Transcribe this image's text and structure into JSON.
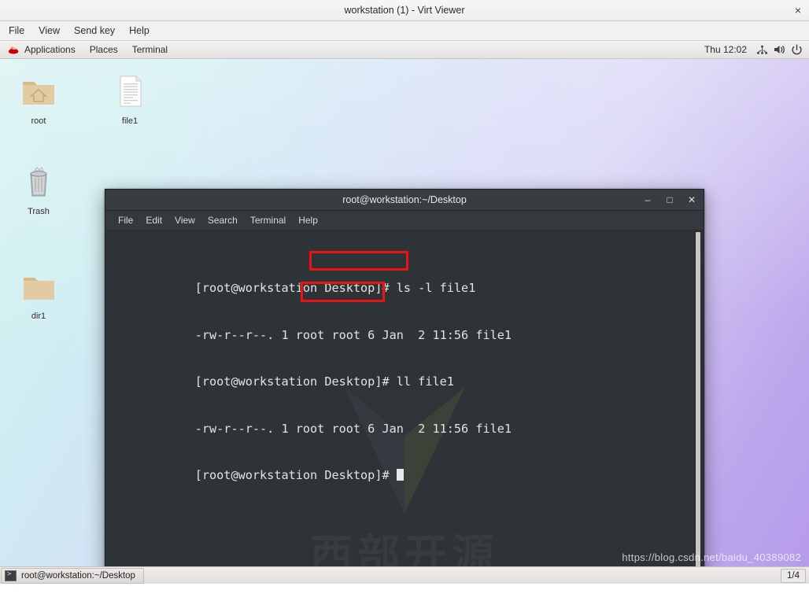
{
  "virt_viewer": {
    "title": "workstation (1) - Virt Viewer",
    "close_label": "×",
    "menu": [
      "File",
      "View",
      "Send key",
      "Help"
    ]
  },
  "gnome_panel": {
    "apps_label": "Applications",
    "places_label": "Places",
    "terminal_label": "Terminal",
    "clock": "Thu 12:02",
    "tray": [
      "network-icon",
      "volume-icon",
      "power-icon"
    ]
  },
  "desktop": {
    "icons": [
      {
        "label": "root",
        "type": "home-folder-icon"
      },
      {
        "label": "file1",
        "type": "text-file-icon"
      },
      {
        "label": "Trash",
        "type": "trash-icon"
      },
      {
        "label": "dir1",
        "type": "folder-icon"
      }
    ]
  },
  "terminal": {
    "title": "root@workstation:~/Desktop",
    "minimize_label": "–",
    "maximize_label": "□",
    "close_label": "✕",
    "menu": [
      "File",
      "Edit",
      "View",
      "Search",
      "Terminal",
      "Help"
    ],
    "watermark_text": "西部开源",
    "prompt": "[root@workstation Desktop]#",
    "lines": [
      {
        "prompt": "[root@workstation Desktop]# ",
        "text": "ls -l file1",
        "highlighted": true
      },
      {
        "prompt": "",
        "text": "-rw-r--r--. 1 root root 6 Jan  2 11:56 file1",
        "highlighted": false
      },
      {
        "prompt": "[root@workstation Desktop]# ",
        "text": "ll file1",
        "highlighted": true
      },
      {
        "prompt": "",
        "text": "-rw-r--r--. 1 root root 6 Jan  2 11:56 file1",
        "highlighted": false
      },
      {
        "prompt": "[root@workstation Desktop]# ",
        "text": "",
        "highlighted": false
      }
    ]
  },
  "taskbar": {
    "window_button": "root@workstation:~/Desktop",
    "page_indicator": "1/4"
  },
  "watermark": {
    "csdn": "https://blog.csdn.net/baidu_40389082"
  },
  "colors": {
    "annotation": "#ee1111",
    "terminal_bg": "#2e3338",
    "titlebar_bg": "#383d42"
  }
}
